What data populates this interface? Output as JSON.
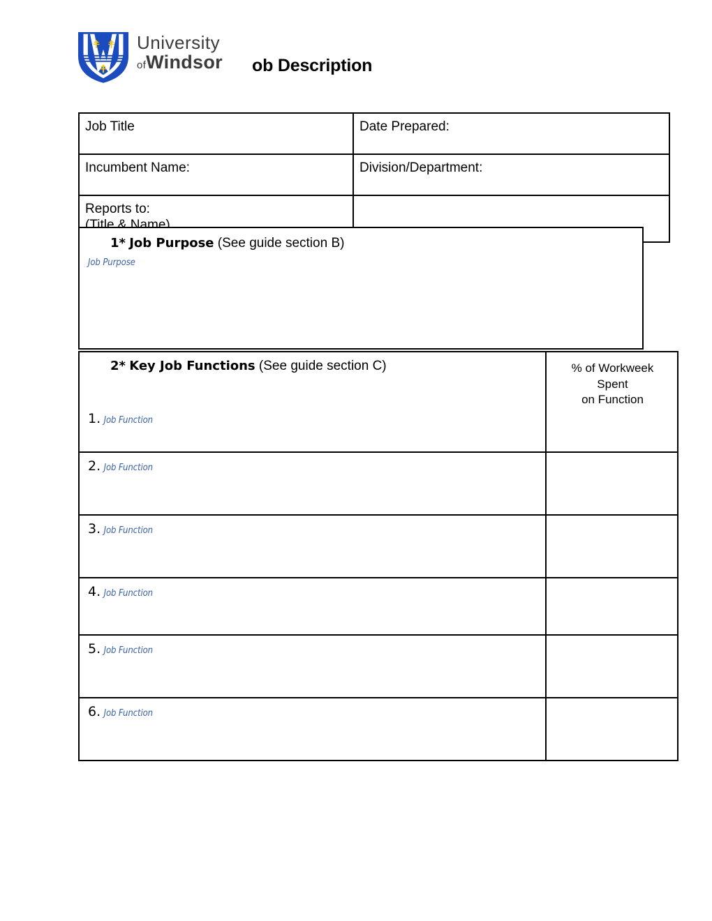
{
  "document": {
    "title": "ob Description",
    "brand": {
      "crest_icon": "university-shield-crest-icon",
      "wordmark_line1": "University",
      "wordmark_of": "of",
      "wordmark_line2": "Windsor"
    }
  },
  "info_table": {
    "rows": [
      {
        "left_label": "Job Title",
        "right_label": "Date Prepared:"
      },
      {
        "left_label": "Incumbent Name:",
        "right_label": "Division/Department:"
      },
      {
        "left_label": "Reports to:\n(Title & Name)",
        "right_label": ""
      }
    ]
  },
  "section_job_purpose": {
    "number": "1*",
    "name": "Job Purpose",
    "guide": "(See guide section B)",
    "placeholder": "Job Purpose"
  },
  "section_key_job_functions": {
    "number": "2*",
    "name": "Key Job Functions",
    "guide": "(See guide section C)",
    "percent_header": "% of Workweek\nSpent\non Function",
    "items": [
      {
        "number": "1.",
        "placeholder": "Job Function",
        "percent": ""
      },
      {
        "number": "2.",
        "placeholder": "Job Function",
        "percent": ""
      },
      {
        "number": "3.",
        "placeholder": "Job Function",
        "percent": ""
      },
      {
        "number": "4.",
        "placeholder": "Job Function",
        "percent": ""
      },
      {
        "number": "5.",
        "placeholder": "Job Function",
        "percent": ""
      },
      {
        "number": "6.",
        "placeholder": "Job Function",
        "percent": ""
      }
    ]
  },
  "colors": {
    "placeholder_blue": "#3a62a8",
    "crest_blue": "#1b4bbd",
    "crest_gold": "#f2c31a",
    "wordmark_gray": "#3b3b3b",
    "rule_black": "#000000"
  }
}
